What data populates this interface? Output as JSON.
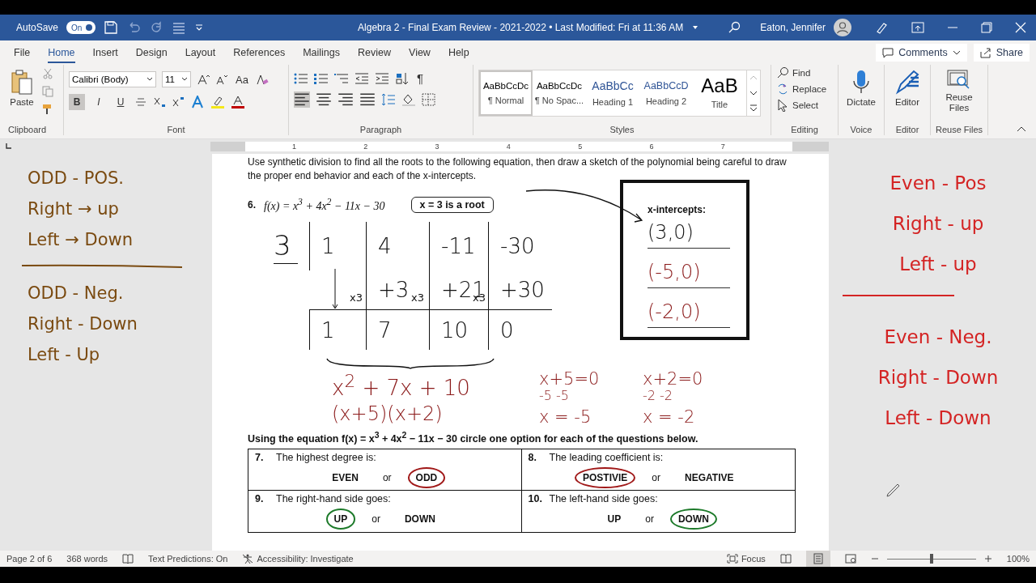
{
  "title_bar": {
    "autosave_label": "AutoSave",
    "autosave_on": true,
    "autosave_state": "On",
    "title": "Algebra 2 - Final Exam Review - 2021-2022 • Last Modified: Fri at 11:36 AM",
    "user": "Eaton, Jennifer"
  },
  "menu_tabs": [
    {
      "label": "File",
      "selected": false
    },
    {
      "label": "Home",
      "selected": true
    },
    {
      "label": "Insert",
      "selected": false
    },
    {
      "label": "Design",
      "selected": false
    },
    {
      "label": "Layout",
      "selected": false
    },
    {
      "label": "References",
      "selected": false
    },
    {
      "label": "Mailings",
      "selected": false
    },
    {
      "label": "Review",
      "selected": false
    },
    {
      "label": "View",
      "selected": false
    },
    {
      "label": "Help",
      "selected": false
    }
  ],
  "comments_button": "Comments",
  "share_button": "Share",
  "ribbon": {
    "clipboard": {
      "paste": "Paste",
      "label": "Clipboard"
    },
    "font": {
      "font_name": "Calibri (Body)",
      "font_size": "11",
      "change_case": "Aa",
      "label": "Font",
      "format_buttons": [
        {
          "label": "B",
          "selected": true
        },
        {
          "label": "I",
          "selected": false
        },
        {
          "label": "U",
          "selected": false
        }
      ]
    },
    "paragraph": {
      "show_marks": "¶",
      "label": "Paragraph",
      "alignments": [
        {
          "kind": "left",
          "selected": true
        },
        {
          "kind": "center",
          "selected": false
        },
        {
          "kind": "right",
          "selected": false
        },
        {
          "kind": "justify",
          "selected": false
        }
      ]
    },
    "styles": {
      "label": "Styles",
      "items": [
        {
          "preview": "AaBbCcDc",
          "name": "¶ Normal",
          "kind": "normal",
          "selected": true
        },
        {
          "preview": "AaBbCcDc",
          "name": "¶ No Spac...",
          "kind": "normal",
          "selected": false
        },
        {
          "preview": "AaBbCc",
          "name": "Heading 1",
          "kind": "heading1",
          "selected": false
        },
        {
          "preview": "AaBbCcD",
          "name": "Heading 2",
          "kind": "heading2",
          "selected": false
        },
        {
          "preview": "AaB",
          "name": "Title",
          "kind": "title",
          "selected": false
        }
      ]
    },
    "editing": {
      "label": "Editing",
      "find": "Find",
      "replace": "Replace",
      "select": "Select"
    },
    "voice": {
      "label": "Voice",
      "button": "Dictate"
    },
    "editor": {
      "label": "Editor",
      "button": "Editor"
    },
    "reuse": {
      "label": "Reuse Files",
      "button": "Reuse Files"
    }
  },
  "ruler": {
    "numbers": [
      "1",
      "2",
      "3",
      "4",
      "5",
      "6",
      "7"
    ]
  },
  "left_notes": {
    "color": "#7a4a10",
    "groups": [
      [
        "ODD - POS.",
        "Right → up",
        "Left → Down"
      ],
      [
        "ODD - Neg.",
        "Right - Down",
        "Left - Up"
      ]
    ]
  },
  "right_notes": {
    "color": "#d42424",
    "groups": [
      [
        "Even - Pos",
        "Right - up",
        "Left - up"
      ],
      [
        "Even - Neg.",
        "Right - Down",
        "Left - Down"
      ]
    ]
  },
  "document": {
    "instructions": "Use synthetic division to find all the roots to the following equation, then draw a sketch of the polynomial being careful to draw the proper end behavior and each of the x-intercepts.",
    "problem": {
      "number": "6.",
      "equation": "f(x) = x$^{3}$ + 4x$^{2}$ − 11x − 30",
      "root_note": "x = 3 is a root"
    },
    "synthetic_division": {
      "divisor": "3",
      "coefficients": [
        "1",
        "4",
        "-11",
        "-30"
      ],
      "products": [
        "+3",
        "+21",
        "+30"
      ],
      "multipliers": [
        "x3",
        "x3",
        "x3"
      ],
      "results": [
        "1",
        "7",
        "10",
        "0"
      ]
    },
    "quotient": "x$^{2}$ + 7x + 10",
    "factored": "(x+5)(x+2)",
    "solutions": [
      {
        "equation": "x+5=0",
        "step": "-5  -5",
        "result": "x = -5"
      },
      {
        "equation": "x+2=0",
        "step": "-2  -2",
        "result": "x = -2"
      }
    ],
    "intercepts": {
      "title": "x-intercepts:",
      "points": [
        {
          "text": "(3,0)",
          "color": "#111111"
        },
        {
          "text": "(-5,0)",
          "color": "#8b1a1a"
        },
        {
          "text": "(-2,0)",
          "color": "#8b1a1a"
        }
      ]
    },
    "question_intro": "Using the equation f(x) = x$^{3}$ + 4x$^{2}$ − 11x − 30 circle one option for each of the questions below.",
    "questions": [
      {
        "number": "7.",
        "prompt": "The highest degree is:",
        "connector": "or",
        "color": "#a01818",
        "options": [
          {
            "label": "EVEN",
            "selected": false
          },
          {
            "label": "ODD",
            "selected": true
          }
        ]
      },
      {
        "number": "8.",
        "prompt": "The leading coefficient is:",
        "connector": "or",
        "color": "#a01818",
        "options": [
          {
            "label": "POSTIVIE",
            "selected": true
          },
          {
            "label": "NEGATIVE",
            "selected": false
          }
        ]
      },
      {
        "number": "9.",
        "prompt": "The right-hand side goes:",
        "connector": "or",
        "color": "#1d7a2a",
        "options": [
          {
            "label": "UP",
            "selected": true
          },
          {
            "label": "DOWN",
            "selected": false
          }
        ]
      },
      {
        "number": "10.",
        "prompt": "The left-hand side goes:",
        "connector": "or",
        "color": "#1d7a2a",
        "options": [
          {
            "label": "UP",
            "selected": false
          },
          {
            "label": "DOWN",
            "selected": true
          }
        ]
      }
    ]
  },
  "status_bar": {
    "page": "Page 2 of 6",
    "words": "368 words",
    "text_predictions": "Text Predictions: On",
    "accessibility": "Accessibility: Investigate",
    "focus": "Focus",
    "zoom_slider": {
      "level": 0.5
    },
    "zoom": "100%"
  }
}
